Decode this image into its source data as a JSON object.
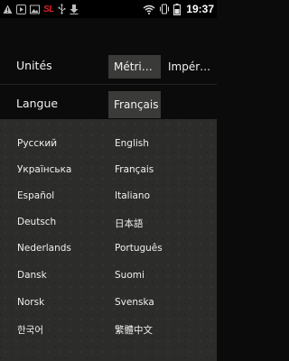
{
  "status_bar": {
    "time": "19:37",
    "left_icons": [
      "warning-icon",
      "play-icon",
      "image-icon",
      "sl-logo-icon",
      "usb-icon",
      "download-icon"
    ],
    "right_icons": [
      "wifi-icon",
      "vibrate-icon",
      "battery-icon"
    ],
    "sl_logo": "SL",
    "accent_color": "#e0202a"
  },
  "settings": {
    "units": {
      "label": "Unités",
      "options": [
        "Métri…",
        "Impér…"
      ],
      "selected_index": 0
    },
    "language": {
      "label": "Langue",
      "value": "Français"
    }
  },
  "language_list": {
    "left": [
      "Русский",
      "Українська",
      "Español",
      "Deutsch",
      "Nederlands",
      "Dansk",
      "Norsk",
      "한국어"
    ],
    "right": [
      "English",
      "Français",
      "Italiano",
      "日本語",
      "Português",
      "Suomi",
      "Svenska",
      "繁體中文"
    ]
  },
  "colors": {
    "background": "#0b0b0b",
    "panel": "#2c2c2b",
    "selected": "#3a3b38"
  }
}
